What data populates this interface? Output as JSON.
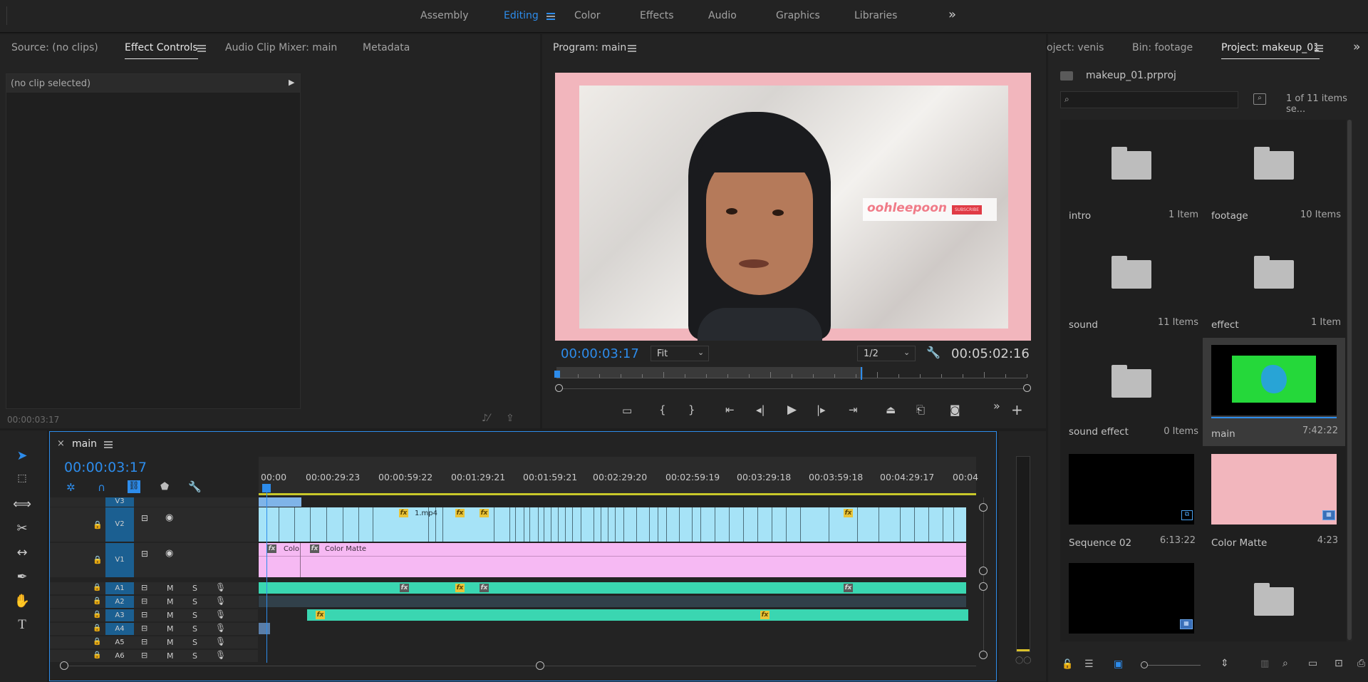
{
  "workspaces": {
    "tabs": [
      {
        "label": "Assembly"
      },
      {
        "label": "Editing"
      },
      {
        "label": "Color"
      },
      {
        "label": "Effects"
      },
      {
        "label": "Audio"
      },
      {
        "label": "Graphics"
      },
      {
        "label": "Libraries"
      }
    ],
    "active": "Editing",
    "overflow_icon": "double-chevron-right-icon"
  },
  "source_panel": {
    "tabs": [
      {
        "label": "Source: (no clips)"
      },
      {
        "label": "Effect Controls"
      },
      {
        "label": "Audio Clip Mixer: main"
      },
      {
        "label": "Metadata"
      }
    ],
    "active": "Effect Controls",
    "no_clip_label": "(no clip selected)",
    "timecode": "00:00:03:17"
  },
  "program_monitor": {
    "title": "Program: main",
    "overlay_text": "oohleepoon",
    "subscribe_label": "SUBSCRIBE",
    "current_timecode": "00:00:03:17",
    "zoom_select": "Fit",
    "resolution_select": "1/2",
    "duration_timecode": "00:05:02:16",
    "playhead_fraction": 0.005
  },
  "project_panel": {
    "tabs": [
      {
        "label": "oject: venis"
      },
      {
        "label": "Bin: footage"
      },
      {
        "label": "Project: makeup_01"
      }
    ],
    "active": "Project: makeup_01",
    "file_name": "makeup_01.prproj",
    "search_placeholder": "",
    "items_count": "1 of 11 items se...",
    "items": [
      {
        "name": "intro",
        "meta": "1 Item",
        "kind": "folder"
      },
      {
        "name": "footage",
        "meta": "10 Items",
        "kind": "folder"
      },
      {
        "name": "sound",
        "meta": "11 Items",
        "kind": "folder"
      },
      {
        "name": "effect",
        "meta": "1 Item",
        "kind": "folder"
      },
      {
        "name": "sound effect",
        "meta": "0 Items",
        "kind": "folder"
      },
      {
        "name": "main",
        "meta": "7:42:22",
        "kind": "sequence-green"
      },
      {
        "name": "Sequence 02",
        "meta": "6:13:22",
        "kind": "sequence-black"
      },
      {
        "name": "Color Matte",
        "meta": "4:23",
        "kind": "matte-pink"
      },
      {
        "name": "",
        "meta": "",
        "kind": "sequence-black"
      },
      {
        "name": "",
        "meta": "",
        "kind": "folder"
      }
    ]
  },
  "timeline": {
    "sequence_name": "main",
    "timecode": "00:00:03:17",
    "ruler": [
      "00:00",
      "00:00:29:23",
      "00:00:59:22",
      "00:01:29:21",
      "00:01:59:21",
      "00:02:29:20",
      "00:02:59:19",
      "00:03:29:18",
      "00:03:59:18",
      "00:04:29:17",
      "00:04"
    ],
    "video_tracks": [
      {
        "label": "V3"
      },
      {
        "label": "V2"
      },
      {
        "label": "V1"
      }
    ],
    "audio_tracks": [
      {
        "label": "A1",
        "m": "M",
        "s": "S"
      },
      {
        "label": "A2",
        "m": "M",
        "s": "S"
      },
      {
        "label": "A3",
        "m": "M",
        "s": "S"
      },
      {
        "label": "A4",
        "m": "M",
        "s": "S"
      },
      {
        "label": "A5",
        "m": "M",
        "s": "S"
      },
      {
        "label": "A6",
        "m": "M",
        "s": "S"
      }
    ],
    "clips": {
      "v2_clip_label": "1.mp4",
      "v1_clip_a_label": "Colo",
      "v1_clip_b_label": "Color Matte",
      "fx_label": "fx"
    }
  },
  "colors": {
    "accent": "#2d8ceb",
    "v2_clip": "#a6e3f7",
    "v1_clip": "#f6b9f3",
    "audio_clip": "#3ad6b1",
    "frame_pink": "#f2b6bd"
  }
}
